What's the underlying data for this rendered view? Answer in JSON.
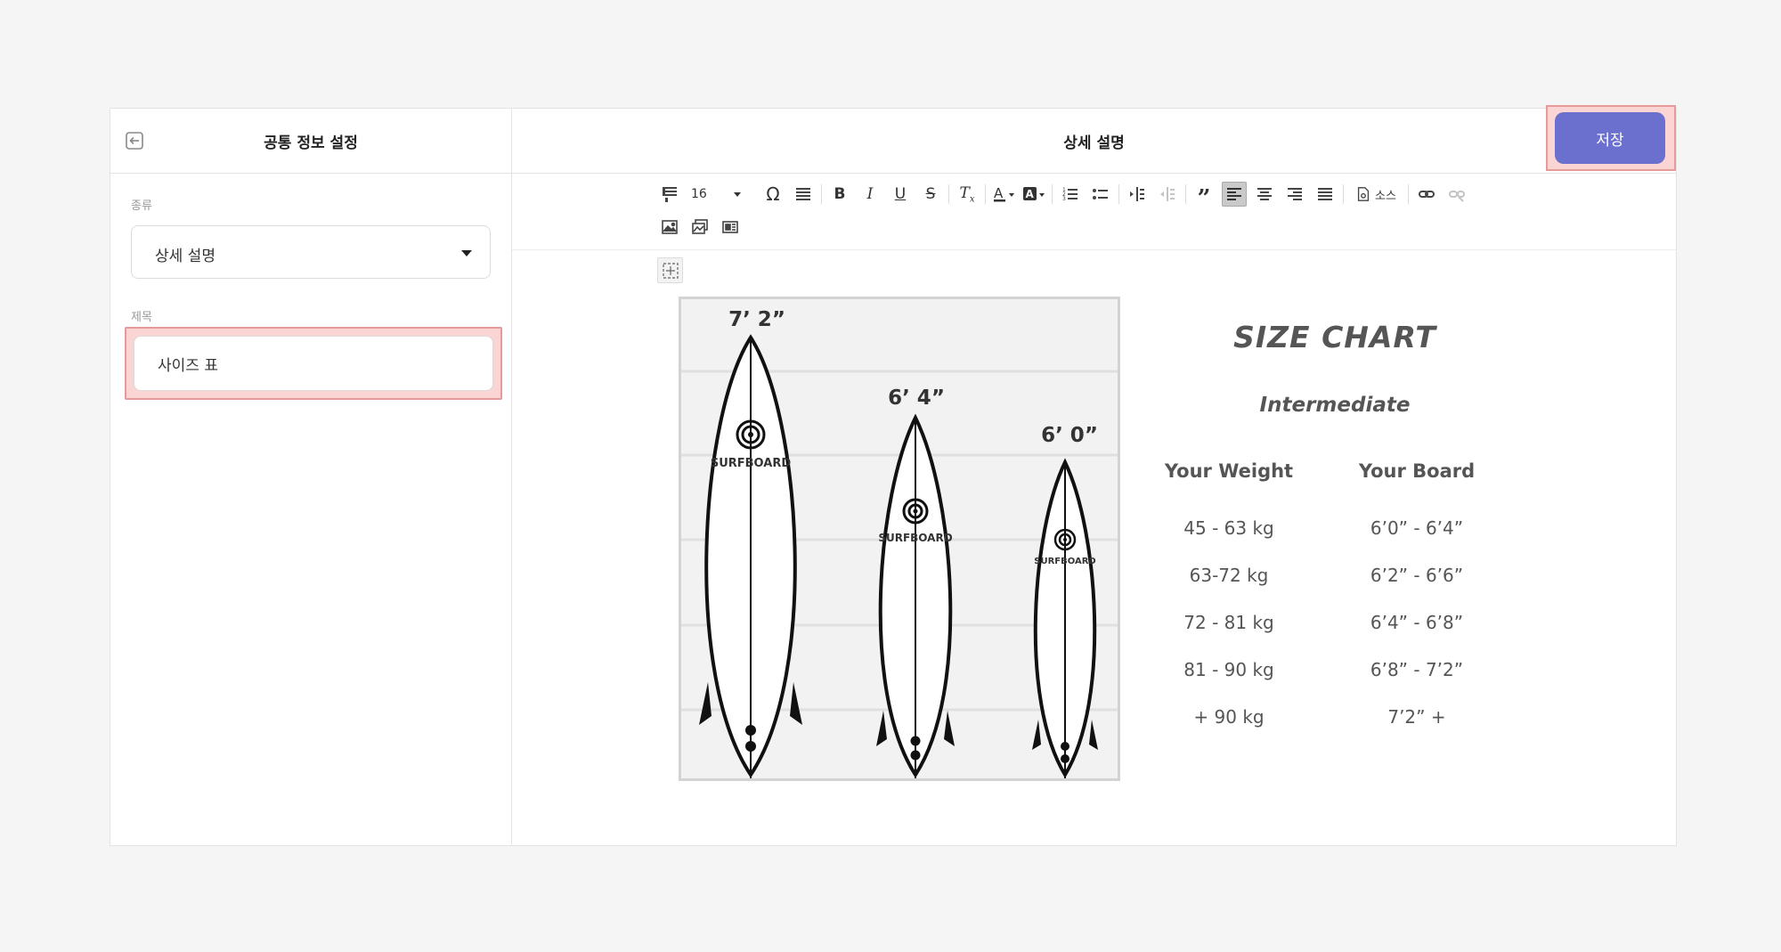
{
  "left_panel": {
    "title": "공통 정보 설정",
    "type_label": "종류",
    "type_value": "상세 설명",
    "title_label": "제목",
    "title_value": "사이즈 표"
  },
  "editor": {
    "title": "상세 설명",
    "save_label": "저장",
    "font_size": "16",
    "source_label": "소스"
  },
  "boards": [
    {
      "size_label": "7’ 2”",
      "brand": "SURFBOARD"
    },
    {
      "size_label": "6’ 4”",
      "brand": "SURFBOARD"
    },
    {
      "size_label": "6’ 0”",
      "brand": "SURFBOARD"
    }
  ],
  "size_chart": {
    "title": "SIZE CHART",
    "subtitle": "Intermediate",
    "col1_header": "Your Weight",
    "col2_header": "Your Board",
    "rows": [
      {
        "weight": "45 - 63 kg",
        "board": "6’0” - 6’4”"
      },
      {
        "weight": "63-72 kg",
        "board": "6’2” - 6’6”"
      },
      {
        "weight": "72 - 81 kg",
        "board": "6’4” - 6’8”"
      },
      {
        "weight": "81 - 90 kg",
        "board": "6’8” - 7’2”"
      },
      {
        "weight": "+ 90 kg",
        "board": "7’2” +"
      }
    ]
  },
  "colors": {
    "accent": "#6b6fce",
    "highlight": "#fbd4d4",
    "highlight_border": "#e79a9a"
  }
}
